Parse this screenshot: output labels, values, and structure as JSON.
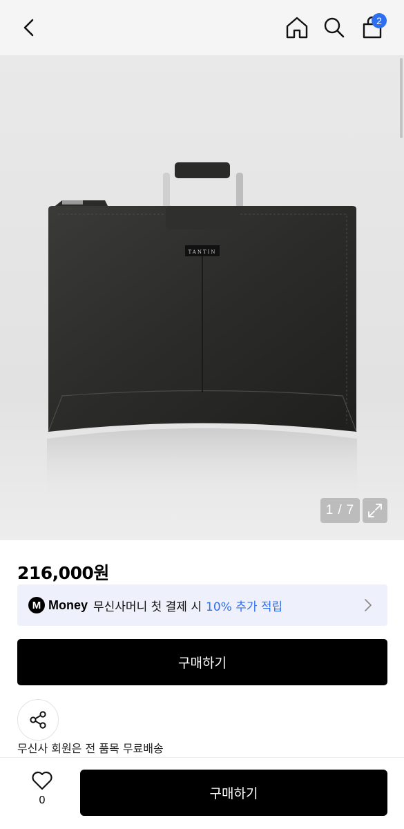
{
  "header": {
    "back_icon": "chevron-left-icon",
    "home_icon": "home-icon",
    "search_icon": "search-icon",
    "cart_icon": "shopping-bag-icon",
    "cart_badge": "2",
    "badge_color": "#2e6ff2"
  },
  "gallery": {
    "product_brand_label": "TANTIN",
    "counter_current": "1",
    "counter_separator": "/",
    "counter_total": "7",
    "expand_icon": "expand-icon"
  },
  "product": {
    "price": "216,000원"
  },
  "money_banner": {
    "logo_letter": "M",
    "logo_word": "Money",
    "text": "무신사머니 첫 결제 시",
    "highlight": "10% 추가 적립",
    "highlight_color": "#2e6ff2"
  },
  "buy_button_label": "구매하기",
  "share_icon": "share-icon",
  "shipping_text": "무신사 회원은 전 품목 무료배송",
  "bottom_bar": {
    "like_icon": "heart-icon",
    "like_count": "0",
    "buy_label": "구매하기"
  }
}
